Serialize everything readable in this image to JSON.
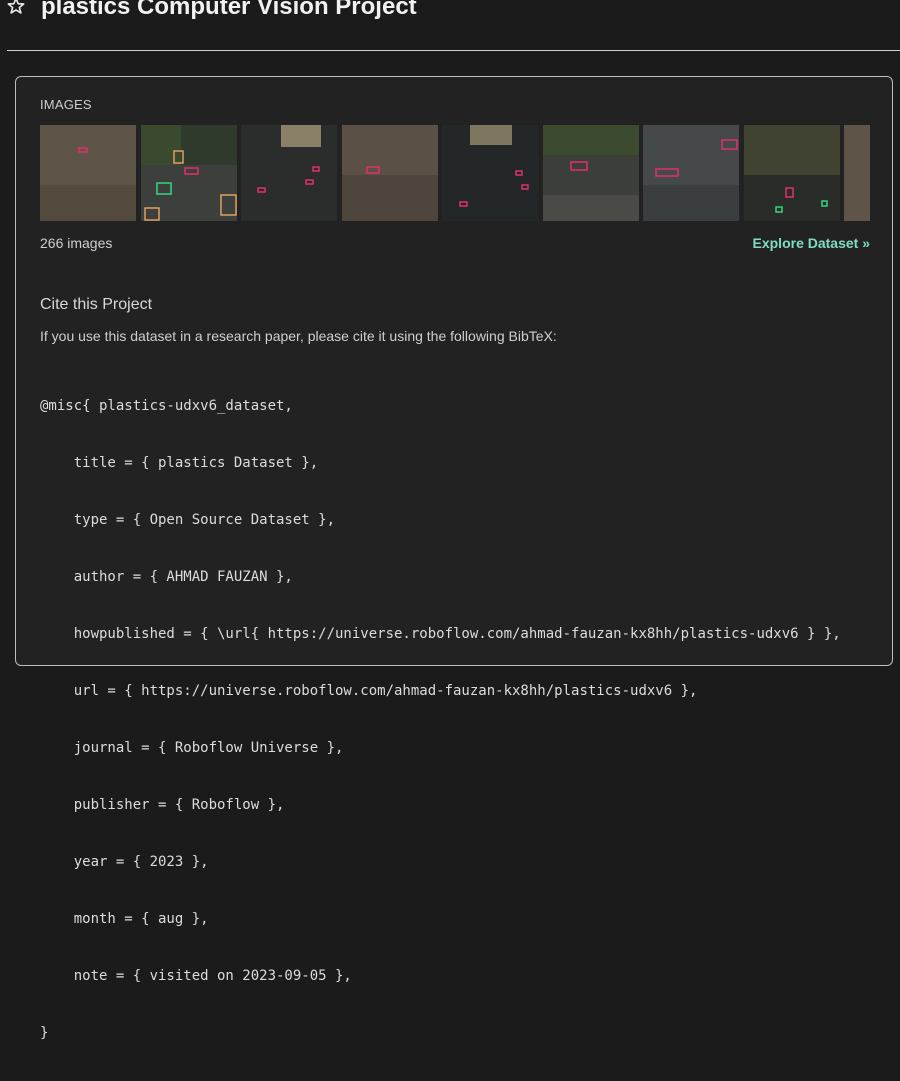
{
  "header": {
    "title": "plastics Computer Vision Project",
    "icon": "star-icon"
  },
  "images": {
    "section_label": "IMAGES",
    "count_text": "266 images",
    "explore_label": "Explore Dataset »"
  },
  "cite": {
    "title": "Cite this Project",
    "description": "If you use this dataset in a research paper, please cite it using the following BibTeX:",
    "bibtex_lines": [
      "@misc{ plastics-udxv6_dataset,",
      "    title = { plastics Dataset },",
      "    type = { Open Source Dataset },",
      "    author = { AHMAD FAUZAN },",
      "    howpublished = { \\url{ https://universe.roboflow.com/ahmad-fauzan-kx8hh/plastics-udxv6 } },",
      "    url = { https://universe.roboflow.com/ahmad-fauzan-kx8hh/plastics-udxv6 },",
      "    journal = { Roboflow Universe },",
      "    publisher = { Roboflow },",
      "    year = { 2023 },",
      "    month = { aug },",
      "    note = { visited on 2023-09-05 },",
      "}"
    ]
  },
  "colors": {
    "accent": "#7fdcc4",
    "annotation": "#e0306a",
    "annotation_alt": "#2ed87a"
  }
}
